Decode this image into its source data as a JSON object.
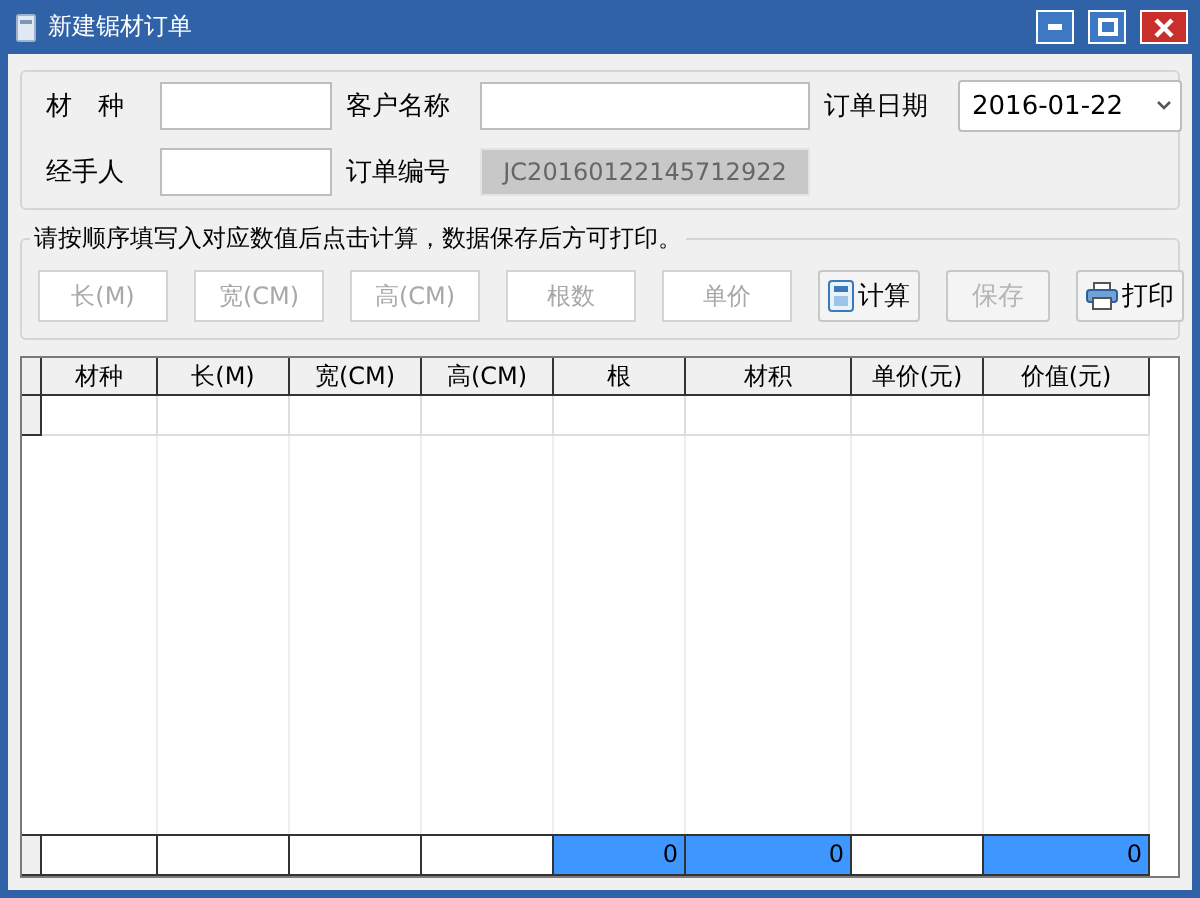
{
  "window": {
    "title": "新建锯材订单"
  },
  "order": {
    "fields": [
      {
        "label": "材　种",
        "kind": "text"
      },
      {
        "label": "客户名称",
        "kind": "text"
      },
      {
        "label": "订单日期",
        "kind": "date",
        "value": "2016-01-22"
      },
      {
        "label": "经手人",
        "kind": "text"
      },
      {
        "label": "订单编号",
        "kind": "readonly",
        "value": "JC20160122145712922"
      }
    ]
  },
  "entry": {
    "legend": "请按顺序填写入对应数值后点击计算，数据保存后方可打印。",
    "inputs": [
      {
        "placeholder": "长(M)"
      },
      {
        "placeholder": "宽(CM)"
      },
      {
        "placeholder": "高(CM)"
      },
      {
        "placeholder": "根数"
      },
      {
        "placeholder": "单价"
      }
    ],
    "buttons": [
      {
        "label": "计算",
        "kind": "calculate",
        "disabled": false
      },
      {
        "label": "保存",
        "kind": "save",
        "disabled": true
      },
      {
        "label": "打印",
        "kind": "print",
        "disabled": false
      }
    ]
  },
  "table": {
    "columns": [
      "材种",
      "长(M)",
      "宽(CM)",
      "高(CM)",
      "根",
      "材积",
      "单价(元)",
      "价值(元)"
    ],
    "footer": [
      {
        "highlighted": false
      },
      {
        "highlighted": false
      },
      {
        "highlighted": false
      },
      {
        "highlighted": false
      },
      {
        "value": "0",
        "highlighted": true
      },
      {
        "value": "0",
        "highlighted": true
      },
      {
        "highlighted": false
      },
      {
        "value": "0",
        "highlighted": true
      }
    ]
  }
}
